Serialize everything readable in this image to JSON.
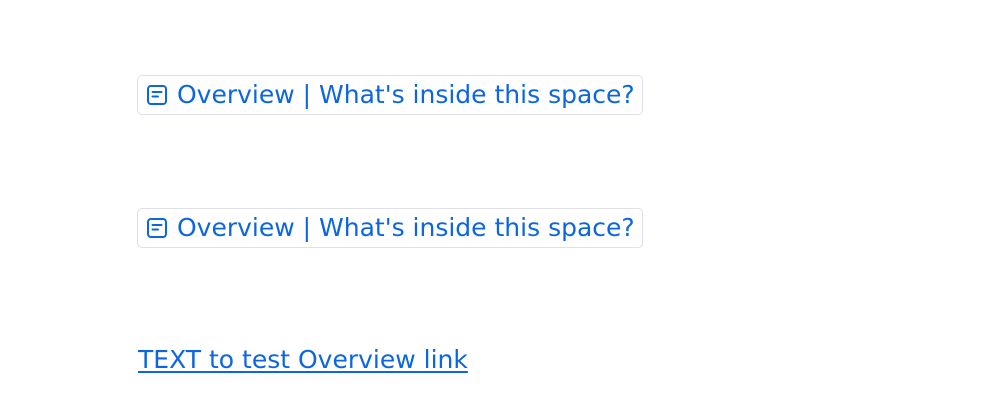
{
  "links": {
    "card_one": {
      "icon": "page-icon",
      "text": "Overview | What's inside this space?"
    },
    "card_two": {
      "icon": "page-icon",
      "text": "Overview | What's inside this space?"
    },
    "text_link": {
      "text": "TEXT to test Overview link"
    }
  },
  "colors": {
    "link": "#0c66e4",
    "border": "#dfe1e6",
    "background": "#ffffff"
  }
}
